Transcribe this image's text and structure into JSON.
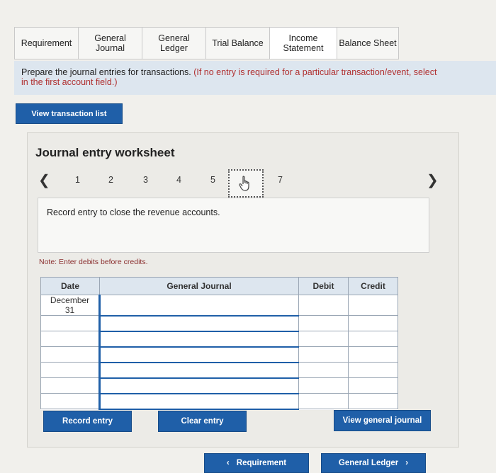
{
  "tabs": [
    {
      "label": "Requirement"
    },
    {
      "label": "General\nJournal"
    },
    {
      "label": "General\nLedger"
    },
    {
      "label": "Trial Balance"
    },
    {
      "label": "Income\nStatement"
    },
    {
      "label": "Balance Sheet"
    }
  ],
  "instruction": {
    "main": "Prepare the journal entries for transactions.",
    "paren_line1": "(If no entry is required for a particular transaction/event, select",
    "line2": "in the first account field.)"
  },
  "buttons": {
    "view_transaction_list": "View transaction list",
    "record_entry": "Record entry",
    "clear_entry": "Clear entry",
    "view_general_journal": "View general journal",
    "prev_requirement": "Requirement",
    "next_general_ledger": "General Ledger"
  },
  "worksheet": {
    "title": "Journal entry worksheet",
    "pages": [
      "1",
      "2",
      "3",
      "4",
      "5",
      "6",
      "7"
    ],
    "current_page": "6",
    "entry_description": "Record entry to close the revenue accounts.",
    "note": "Note: Enter debits before credits."
  },
  "table": {
    "headers": {
      "date": "Date",
      "general_journal": "General Journal",
      "debit": "Debit",
      "credit": "Credit"
    },
    "date_value": "December\n31",
    "row_count": 7
  },
  "icons": {
    "prev": "chevron-left-icon",
    "next": "chevron-right-icon",
    "cursor": "hand-cursor-icon"
  }
}
